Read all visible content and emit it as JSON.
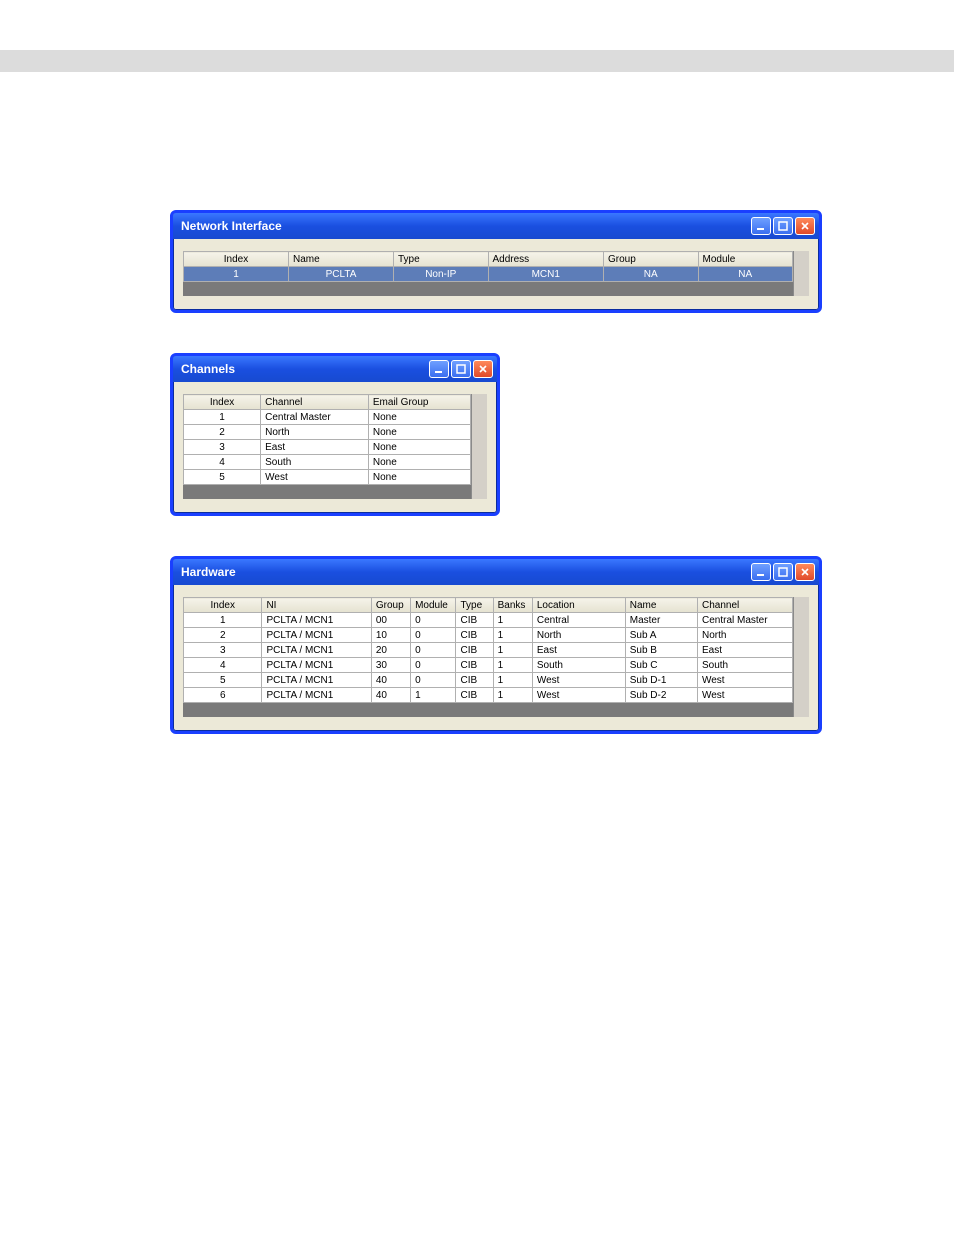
{
  "networkInterface": {
    "title": "Network Interface",
    "headers": [
      "Index",
      "Name",
      "Type",
      "Address",
      "Group",
      "Module"
    ],
    "rows": [
      {
        "Index": "1",
        "Name": "PCLTA",
        "Type": "Non-IP",
        "Address": "MCN1",
        "Group": "NA",
        "Module": "NA",
        "selected": true
      }
    ]
  },
  "channels": {
    "title": "Channels",
    "headers": [
      "Index",
      "Channel",
      "Email Group"
    ],
    "rows": [
      {
        "Index": "1",
        "Channel": "Central Master",
        "Email Group": "None"
      },
      {
        "Index": "2",
        "Channel": "North",
        "Email Group": "None"
      },
      {
        "Index": "3",
        "Channel": "East",
        "Email Group": "None"
      },
      {
        "Index": "4",
        "Channel": "South",
        "Email Group": "None"
      },
      {
        "Index": "5",
        "Channel": "West",
        "Email Group": "None"
      }
    ]
  },
  "hardware": {
    "title": "Hardware",
    "headers": [
      "Index",
      "NI",
      "Group",
      "Module",
      "Type",
      "Banks",
      "Location",
      "Name",
      "Channel"
    ],
    "rows": [
      {
        "Index": "1",
        "NI": "PCLTA / MCN1",
        "Group": "00",
        "Module": "0",
        "Type": "CIB",
        "Banks": "1",
        "Location": "Central",
        "Name": "Master",
        "Channel": "Central Master"
      },
      {
        "Index": "2",
        "NI": "PCLTA / MCN1",
        "Group": "10",
        "Module": "0",
        "Type": "CIB",
        "Banks": "1",
        "Location": "North",
        "Name": "Sub A",
        "Channel": "North"
      },
      {
        "Index": "3",
        "NI": "PCLTA / MCN1",
        "Group": "20",
        "Module": "0",
        "Type": "CIB",
        "Banks": "1",
        "Location": "East",
        "Name": "Sub B",
        "Channel": "East"
      },
      {
        "Index": "4",
        "NI": "PCLTA / MCN1",
        "Group": "30",
        "Module": "0",
        "Type": "CIB",
        "Banks": "1",
        "Location": "South",
        "Name": "Sub C",
        "Channel": "South"
      },
      {
        "Index": "5",
        "NI": "PCLTA / MCN1",
        "Group": "40",
        "Module": "0",
        "Type": "CIB",
        "Banks": "1",
        "Location": "West",
        "Name": "Sub D-1",
        "Channel": "West"
      },
      {
        "Index": "6",
        "NI": "PCLTA / MCN1",
        "Group": "40",
        "Module": "1",
        "Type": "CIB",
        "Banks": "1",
        "Location": "West",
        "Name": "Sub D-2",
        "Channel": "West"
      }
    ]
  }
}
